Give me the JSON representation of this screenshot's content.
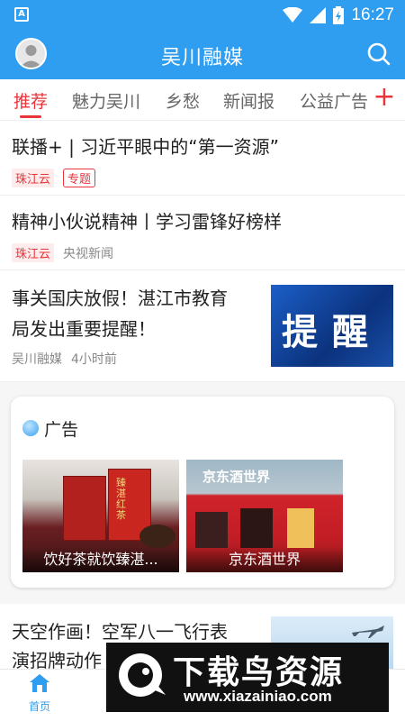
{
  "status_bar": {
    "time": "16:27",
    "app_icon": "A"
  },
  "header": {
    "title": "吴川融媒",
    "avatar_icon": "user-avatar-icon",
    "search_icon": "search-icon"
  },
  "tabs": [
    {
      "label": "推荐",
      "active": true
    },
    {
      "label": "魅力吴川"
    },
    {
      "label": "乡愁"
    },
    {
      "label": "新闻报"
    },
    {
      "label": "公益广告"
    }
  ],
  "tabs_add": "+",
  "news": [
    {
      "title": "联播+ | 习近平眼中的“第一资源”",
      "source": "珠江云",
      "tag": "专题"
    },
    {
      "title": "精神小伙说精神丨学习雷锋好榜样",
      "source": "珠江云",
      "publisher": "央视新闻"
    },
    {
      "title_line1": "事关国庆放假！湛江市教育",
      "title_line2": "局发出重要提醒！",
      "publisher": "吴川融媒",
      "time": "4小时前",
      "thumb_text": "提醒"
    },
    {
      "title_line1": "天空作画！空军八一飞行表",
      "title_line2": "演招牌动作"
    }
  ],
  "ad": {
    "label": "广告",
    "items": [
      {
        "caption": "饮好茶就饮臻湛...",
        "sign": "臻湛红茶"
      },
      {
        "caption": "京东酒世界",
        "sign": "京东酒世界"
      }
    ]
  },
  "bottom_nav": {
    "home_label": "首页"
  },
  "watermark": {
    "title": "下载鸟资源",
    "url": "www.xiazainiao.com"
  },
  "colors": {
    "primary": "#2f9ef1",
    "accent": "#e8343a"
  }
}
